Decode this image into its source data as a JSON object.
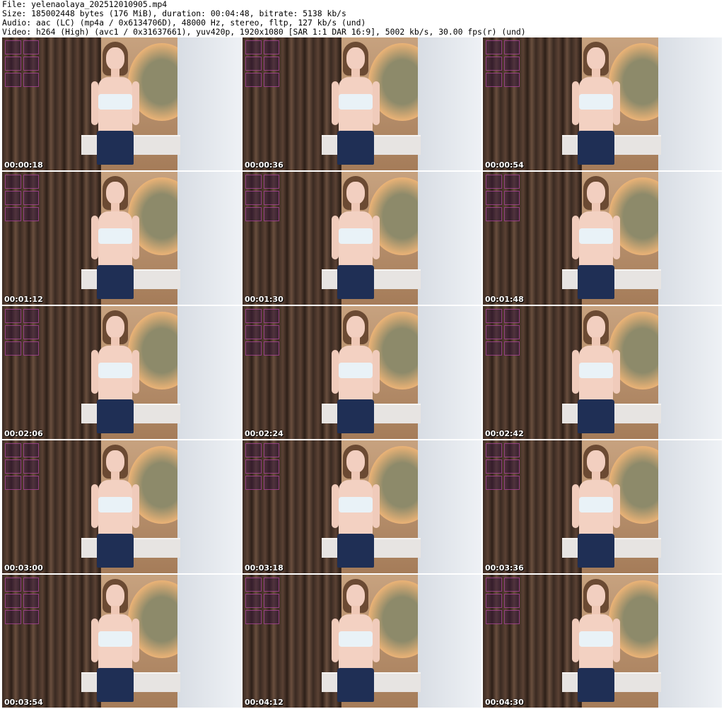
{
  "header": {
    "file_line": "File: yelenaolaya_202512010905.mp4",
    "size_line": "Size: 185002448 bytes (176 MiB), duration: 00:04:48, bitrate: 5138 kb/s",
    "audio_line": "Audio: aac (LC) (mp4a / 0x6134706D), 48000 Hz, stereo, fltp, 127 kb/s (und)",
    "video_line": "Video: h264 (High) (avc1 / 0x31637661), yuv420p, 1920x1080 [SAR 1:1 DAR 16:9], 5002 kb/s, 30.00 fps(r) (und)"
  },
  "thumbnails": [
    {
      "timestamp": "00:00:18"
    },
    {
      "timestamp": "00:00:36"
    },
    {
      "timestamp": "00:00:54"
    },
    {
      "timestamp": "00:01:12"
    },
    {
      "timestamp": "00:01:30"
    },
    {
      "timestamp": "00:01:48"
    },
    {
      "timestamp": "00:02:06"
    },
    {
      "timestamp": "00:02:24"
    },
    {
      "timestamp": "00:02:42"
    },
    {
      "timestamp": "00:03:00"
    },
    {
      "timestamp": "00:03:18"
    },
    {
      "timestamp": "00:03:36"
    },
    {
      "timestamp": "00:03:54"
    },
    {
      "timestamp": "00:04:12"
    },
    {
      "timestamp": "00:04:30"
    }
  ]
}
